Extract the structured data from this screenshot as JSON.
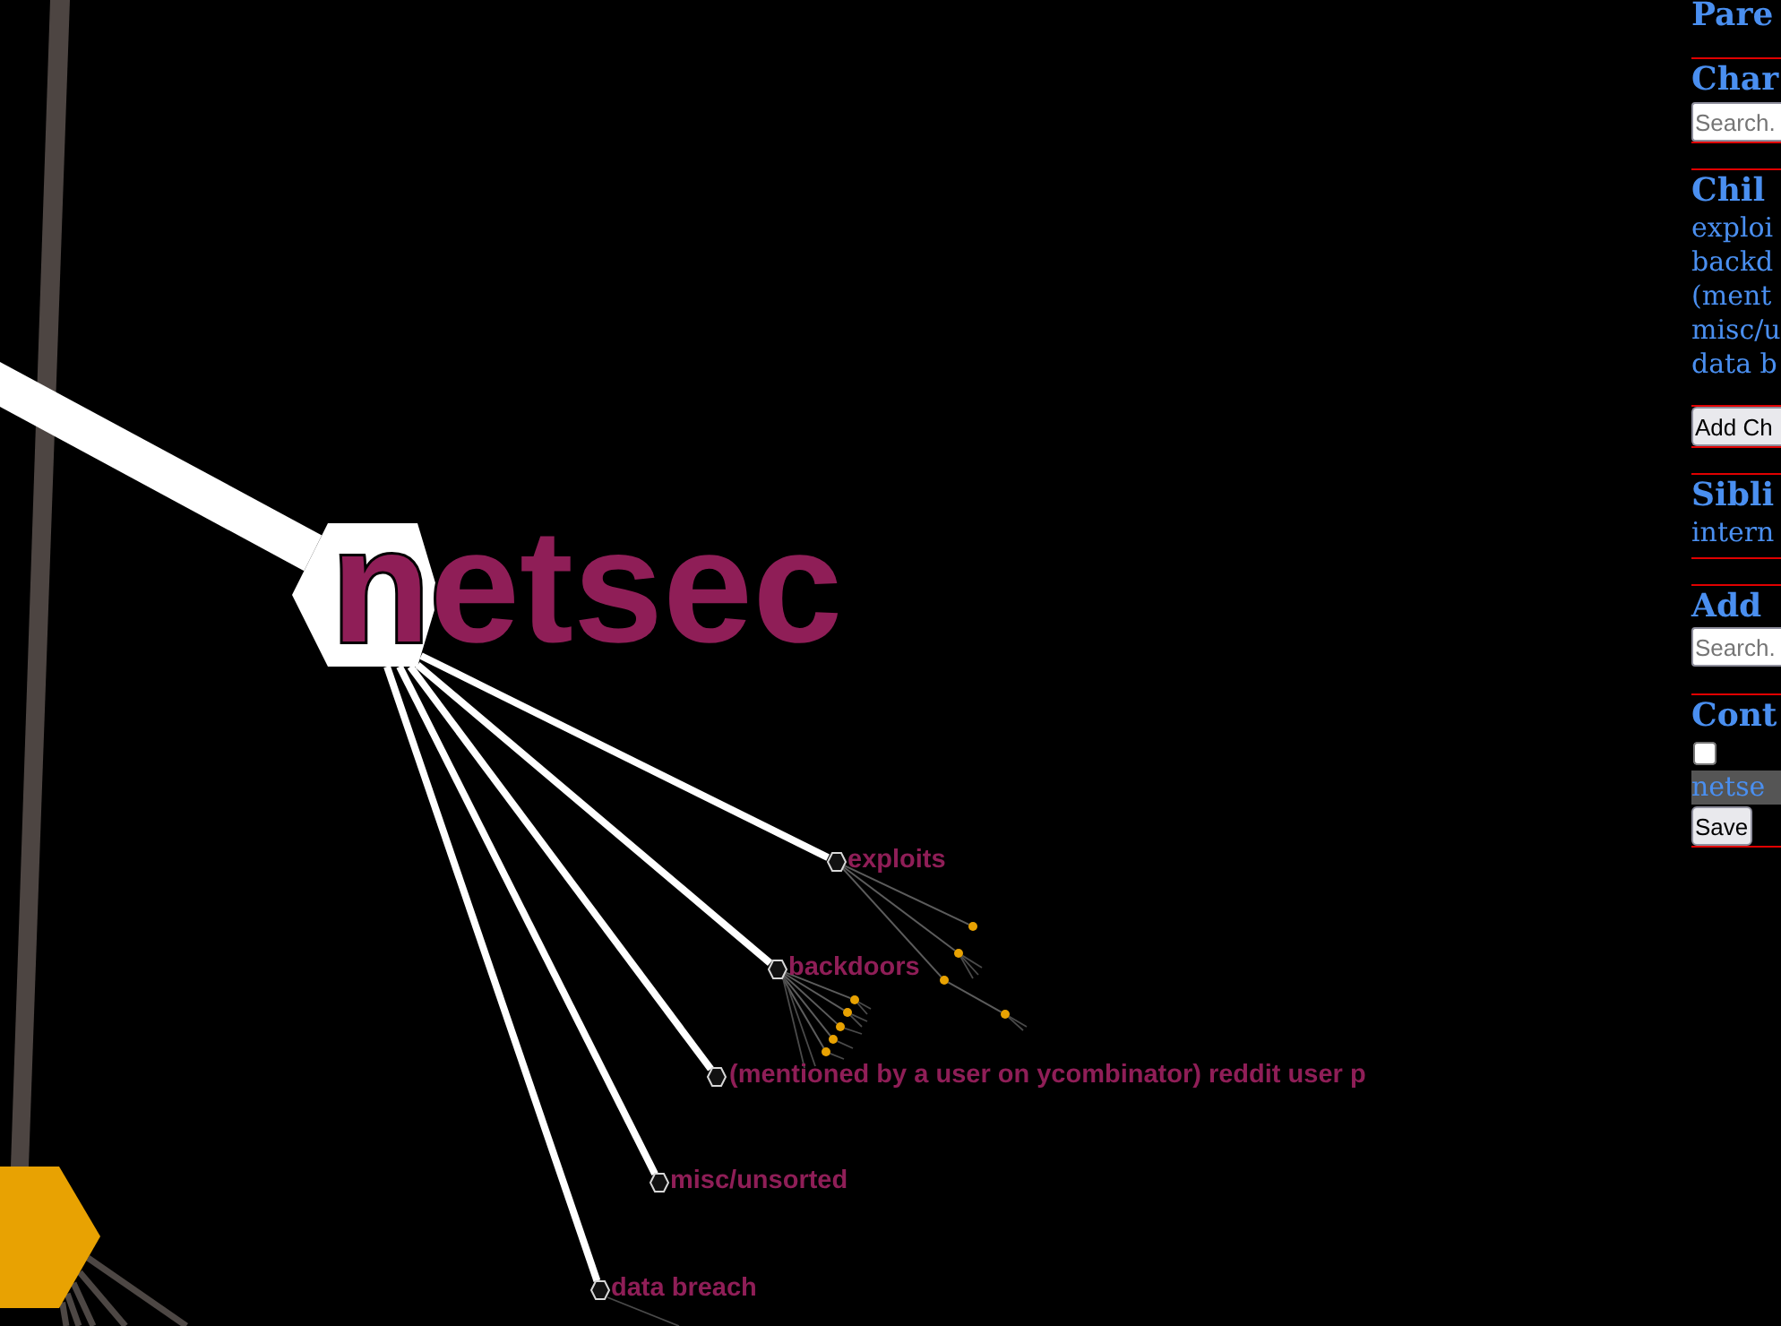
{
  "graph": {
    "focus_node": {
      "label": "netsec"
    },
    "child_nodes": [
      {
        "label": "exploits"
      },
      {
        "label": "backdoors"
      },
      {
        "label": "(mentioned by a user on ycombinator) reddit user p"
      },
      {
        "label": "misc/unsorted"
      },
      {
        "label": "data breach"
      }
    ]
  },
  "sidebar": {
    "parents": {
      "heading": "Pare"
    },
    "change_parent": {
      "heading": "Char",
      "search": {
        "placeholder": "Search."
      }
    },
    "children": {
      "heading": "Chil",
      "items": [
        "exploi",
        "backd",
        "(ment",
        "misc/u",
        "data b"
      ],
      "button": "Add Ch"
    },
    "siblings": {
      "heading": "Sibli",
      "items": [
        "intern"
      ]
    },
    "add_parent": {
      "heading": "Add",
      "search": {
        "placeholder": "Search."
      }
    },
    "content": {
      "heading": "Cont",
      "checkbox": {
        "checked": false
      },
      "value": "netse",
      "button": "Save"
    }
  }
}
